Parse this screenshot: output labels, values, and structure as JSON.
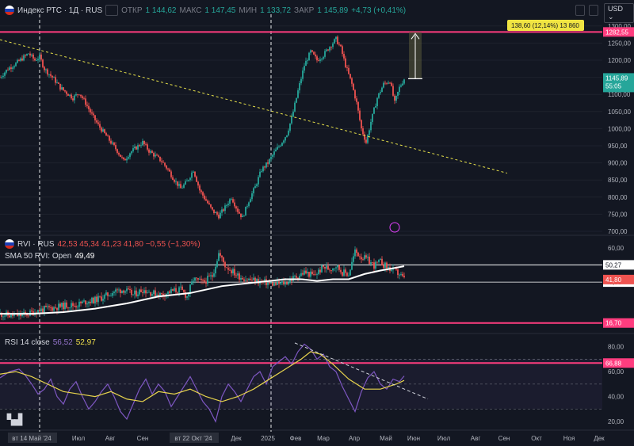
{
  "header": {
    "symbol": "Индекс РТС · 1Д · RUS",
    "ohlc": [
      {
        "k": "ОТКР",
        "v": "1 144,62"
      },
      {
        "k": "МАКС",
        "v": "1 147,45"
      },
      {
        "k": "МИН",
        "v": "1 133,72"
      },
      {
        "k": "ЗАКР",
        "v": "1 145,89"
      }
    ],
    "change": "+4,73 (+0,41%)",
    "currency": "USD"
  },
  "rvi_header": {
    "name": "RVI · RUS",
    "values": "42,53  45,34  41,23  41,80  −0,55 (−1,30%)",
    "sma_label": "SMA 50 RVI: Open",
    "sma_value": "49,49"
  },
  "rsi_header": {
    "name": "RSI 14 close",
    "v1": "56,52",
    "v2": "52,97"
  },
  "colors": {
    "bg": "#131722",
    "up": "#26a69a",
    "down": "#ef5350",
    "magenta": "#ff3d7f",
    "trend": "#e8e24a",
    "rsi": "#7e57c2",
    "rsi_ma": "#e8d44d"
  },
  "chart_data": [
    {
      "type": "candlestick",
      "title": "Индекс РТС · 1Д · RUS",
      "ylim": [
        700,
        1325
      ],
      "y_ticks": [
        "1300,00",
        "1250,00",
        "1200,00",
        "1150,00",
        "1100,00",
        "1050,00",
        "1000,00",
        "950,00",
        "900,00",
        "850,00",
        "800,00",
        "750,00",
        "700,00"
      ],
      "close_series": [
        [
          0,
          1150
        ],
        [
          5,
          1175
        ],
        [
          10,
          1190
        ],
        [
          14,
          1205
        ],
        [
          18,
          1220
        ],
        [
          22,
          1200
        ],
        [
          25,
          1210
        ],
        [
          28,
          1175
        ],
        [
          31,
          1160
        ],
        [
          34,
          1145
        ],
        [
          38,
          1120
        ],
        [
          42,
          1105
        ],
        [
          46,
          1090
        ],
        [
          50,
          1105
        ],
        [
          54,
          1075
        ],
        [
          58,
          1040
        ],
        [
          62,
          1010
        ],
        [
          66,
          985
        ],
        [
          70,
          960
        ],
        [
          74,
          935
        ],
        [
          78,
          905
        ],
        [
          82,
          930
        ],
        [
          86,
          945
        ],
        [
          90,
          960
        ],
        [
          94,
          935
        ],
        [
          98,
          920
        ],
        [
          102,
          905
        ],
        [
          106,
          880
        ],
        [
          110,
          850
        ],
        [
          114,
          825
        ],
        [
          118,
          845
        ],
        [
          122,
          880
        ],
        [
          126,
          820
        ],
        [
          130,
          790
        ],
        [
          134,
          760
        ],
        [
          138,
          745
        ],
        [
          142,
          770
        ],
        [
          146,
          800
        ],
        [
          150,
          760
        ],
        [
          153,
          740
        ],
        [
          157,
          790
        ],
        [
          161,
          830
        ],
        [
          165,
          880
        ],
        [
          169,
          900
        ],
        [
          173,
          930
        ],
        [
          177,
          955
        ],
        [
          181,
          985
        ],
        [
          184,
          1030
        ],
        [
          188,
          1110
        ],
        [
          192,
          1185
        ],
        [
          196,
          1225
        ],
        [
          200,
          1200
        ],
        [
          204,
          1215
        ],
        [
          208,
          1240
        ],
        [
          212,
          1262
        ],
        [
          215,
          1235
        ],
        [
          218,
          1185
        ],
        [
          222,
          1130
        ],
        [
          225,
          1075
        ],
        [
          228,
          1000
        ],
        [
          231,
          960
        ],
        [
          234,
          1020
        ],
        [
          238,
          1090
        ],
        [
          242,
          1130
        ],
        [
          246,
          1140
        ],
        [
          249,
          1075
        ],
        [
          252,
          1120
        ],
        [
          255,
          1145.89
        ]
      ],
      "horizontal_levels": [
        "1282,55"
      ],
      "trendline": [
        [
          0,
          1260
        ],
        [
          320,
          870
        ]
      ],
      "last_price": "1145,89",
      "countdown": "55:05",
      "measure_label": "138,60 (12,14%) 13 860",
      "x_ticks": [
        "вт 14 Май '24",
        "Июл",
        "Авг",
        "Сен",
        "вт 22 Окт '24",
        "Дек",
        "2025",
        "Фев",
        "Мар",
        "Апр",
        "Май",
        "Июн",
        "Июл",
        "Авг",
        "Сен",
        "Окт",
        "Ноя",
        "Дек"
      ]
    },
    {
      "type": "line",
      "title": "RVI · RUS",
      "ylim": [
        12,
        66
      ],
      "y_ticks": [
        "60,00"
      ],
      "levels": [
        "50,27",
        "40,33",
        "16,70"
      ],
      "last_value": "41,80",
      "rvi": [
        [
          0,
          22
        ],
        [
          6,
          21
        ],
        [
          12,
          21
        ],
        [
          18,
          22
        ],
        [
          24,
          24
        ],
        [
          30,
          25
        ],
        [
          36,
          26
        ],
        [
          42,
          27
        ],
        [
          48,
          27
        ],
        [
          54,
          29
        ],
        [
          60,
          30
        ],
        [
          66,
          32
        ],
        [
          72,
          35
        ],
        [
          78,
          36
        ],
        [
          84,
          33
        ],
        [
          90,
          36
        ],
        [
          96,
          34
        ],
        [
          102,
          33
        ],
        [
          108,
          35
        ],
        [
          114,
          36
        ],
        [
          118,
          32
        ],
        [
          122,
          42
        ],
        [
          128,
          40
        ],
        [
          134,
          44
        ],
        [
          138,
          57
        ],
        [
          142,
          50
        ],
        [
          146,
          47
        ],
        [
          150,
          44
        ],
        [
          156,
          42
        ],
        [
          162,
          41
        ],
        [
          168,
          40
        ],
        [
          174,
          39
        ],
        [
          180,
          40
        ],
        [
          186,
          43
        ],
        [
          192,
          46
        ],
        [
          198,
          44
        ],
        [
          204,
          49
        ],
        [
          208,
          48
        ],
        [
          212,
          50
        ],
        [
          216,
          46
        ],
        [
          220,
          45
        ],
        [
          224,
          58
        ],
        [
          228,
          55
        ],
        [
          232,
          53
        ],
        [
          236,
          50
        ],
        [
          240,
          52
        ],
        [
          244,
          49
        ],
        [
          248,
          47
        ],
        [
          252,
          45
        ],
        [
          255,
          41.8
        ]
      ],
      "sma": [
        [
          0,
          22
        ],
        [
          20,
          22
        ],
        [
          40,
          23
        ],
        [
          60,
          25
        ],
        [
          80,
          28
        ],
        [
          100,
          32
        ],
        [
          120,
          34
        ],
        [
          140,
          38
        ],
        [
          160,
          40
        ],
        [
          180,
          42
        ],
        [
          190,
          42
        ],
        [
          200,
          41
        ],
        [
          210,
          42
        ],
        [
          220,
          42
        ],
        [
          230,
          45
        ],
        [
          240,
          47
        ],
        [
          255,
          49.49
        ]
      ]
    },
    {
      "type": "line",
      "title": "RSI 14 close",
      "ylim": [
        15,
        88
      ],
      "y_ticks": [
        "80,00",
        "60,00",
        "40,00",
        "20,00"
      ],
      "levels": [
        "66,88"
      ],
      "rsi": [
        [
          0,
          55
        ],
        [
          6,
          60
        ],
        [
          12,
          62
        ],
        [
          16,
          57
        ],
        [
          20,
          50
        ],
        [
          24,
          42
        ],
        [
          28,
          46
        ],
        [
          32,
          54
        ],
        [
          36,
          40
        ],
        [
          40,
          34
        ],
        [
          44,
          46
        ],
        [
          48,
          52
        ],
        [
          52,
          40
        ],
        [
          56,
          30
        ],
        [
          60,
          36
        ],
        [
          64,
          44
        ],
        [
          68,
          50
        ],
        [
          72,
          40
        ],
        [
          76,
          28
        ],
        [
          80,
          22
        ],
        [
          84,
          34
        ],
        [
          88,
          46
        ],
        [
          92,
          54
        ],
        [
          96,
          42
        ],
        [
          100,
          50
        ],
        [
          104,
          44
        ],
        [
          108,
          32
        ],
        [
          112,
          40
        ],
        [
          116,
          48
        ],
        [
          120,
          56
        ],
        [
          124,
          46
        ],
        [
          128,
          36
        ],
        [
          132,
          30
        ],
        [
          136,
          20
        ],
        [
          140,
          40
        ],
        [
          144,
          50
        ],
        [
          148,
          44
        ],
        [
          152,
          36
        ],
        [
          156,
          46
        ],
        [
          160,
          56
        ],
        [
          164,
          60
        ],
        [
          168,
          50
        ],
        [
          172,
          64
        ],
        [
          176,
          68
        ],
        [
          180,
          72
        ],
        [
          184,
          66
        ],
        [
          188,
          76
        ],
        [
          192,
          82
        ],
        [
          196,
          78
        ],
        [
          200,
          70
        ],
        [
          204,
          74
        ],
        [
          208,
          64
        ],
        [
          212,
          60
        ],
        [
          216,
          48
        ],
        [
          220,
          38
        ],
        [
          224,
          28
        ],
        [
          228,
          44
        ],
        [
          232,
          55
        ],
        [
          236,
          60
        ],
        [
          240,
          50
        ],
        [
          244,
          46
        ],
        [
          248,
          54
        ],
        [
          252,
          52
        ],
        [
          255,
          56.52
        ]
      ],
      "rsi_ma": [
        [
          0,
          58
        ],
        [
          10,
          60
        ],
        [
          20,
          56
        ],
        [
          30,
          50
        ],
        [
          40,
          44
        ],
        [
          50,
          42
        ],
        [
          60,
          40
        ],
        [
          70,
          44
        ],
        [
          80,
          38
        ],
        [
          90,
          36
        ],
        [
          100,
          44
        ],
        [
          110,
          42
        ],
        [
          120,
          46
        ],
        [
          130,
          40
        ],
        [
          140,
          36
        ],
        [
          150,
          40
        ],
        [
          160,
          46
        ],
        [
          170,
          54
        ],
        [
          180,
          62
        ],
        [
          190,
          70
        ],
        [
          196,
          76
        ],
        [
          202,
          74
        ],
        [
          210,
          66
        ],
        [
          220,
          54
        ],
        [
          230,
          46
        ],
        [
          240,
          46
        ],
        [
          250,
          50
        ],
        [
          255,
          52.97
        ]
      ],
      "trendline": [
        [
          186,
          83
        ],
        [
          255,
          52
        ]
      ]
    }
  ]
}
